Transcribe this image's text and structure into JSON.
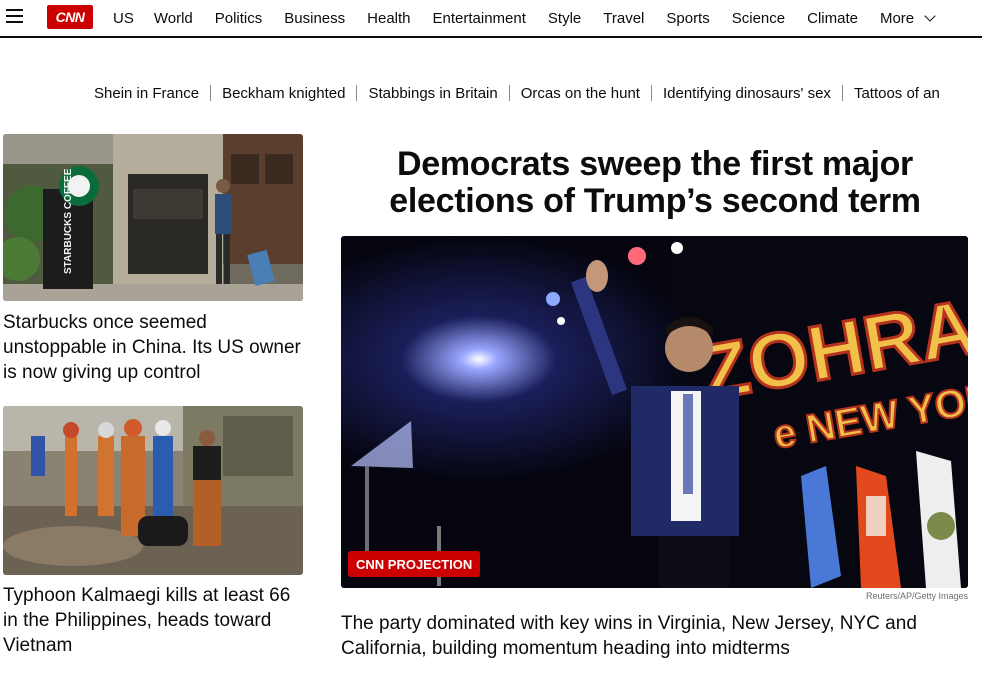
{
  "brand": {
    "logo_text": "CNN",
    "accent": "#cc0000"
  },
  "nav": {
    "items": [
      "US",
      "World",
      "Politics",
      "Business",
      "Health",
      "Entertainment",
      "Style",
      "Travel",
      "Sports",
      "Science",
      "Climate"
    ],
    "more_label": "More"
  },
  "trending": [
    "Shein in France",
    "Beckham knighted",
    "Stabbings in Britain",
    "Orcas on the hunt",
    "Identifying dinosaurs' sex",
    "Tattoos of an"
  ],
  "left_stories": [
    {
      "headline": "Starbucks once seemed unstoppable in China. Its US owner is now giving up control",
      "image_sign_text": "STARBUCKS COFFEE"
    },
    {
      "headline": "Typhoon Kalmaegi kills at least 66 in the Philippines, heads toward Vietnam"
    }
  ],
  "main_story": {
    "headline": "Democrats sweep the first major elections of Trump’s second term",
    "badge": "CNN PROJECTION",
    "photo_credit": "Reuters/AP/Getty Images",
    "subheadline": "The party dominated with key wins in Virginia, New Jersey, NYC and California, building momentum heading into midterms",
    "backdrop_line1": "ZOHRA",
    "backdrop_line2": "e NEW YORK"
  }
}
